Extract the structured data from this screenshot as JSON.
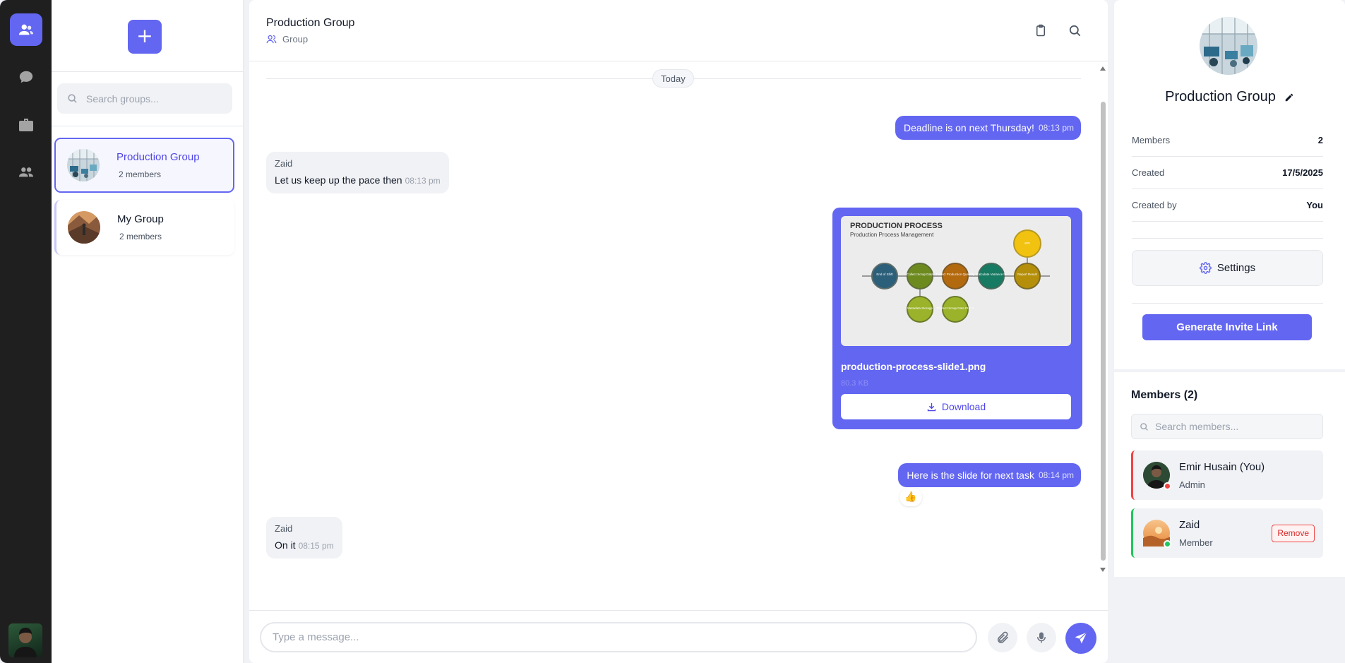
{
  "nav": {
    "items": [
      {
        "name": "groups",
        "icon": "users-icon",
        "active": true
      },
      {
        "name": "chats",
        "icon": "chat-bubble-icon",
        "active": false
      },
      {
        "name": "work",
        "icon": "briefcase-icon",
        "active": false
      },
      {
        "name": "contacts",
        "icon": "contacts-icon",
        "active": false
      }
    ]
  },
  "groups_panel": {
    "add_label": "+",
    "search_placeholder": "Search groups...",
    "groups": [
      {
        "name": "Production Group",
        "members": "2 members",
        "active": true
      },
      {
        "name": "My Group",
        "members": "2 members",
        "active": false
      }
    ]
  },
  "chat": {
    "title": "Production Group",
    "subtitle": "Group",
    "day_separator": "Today",
    "messages": [
      {
        "direction": "out",
        "text": "Deadline is on next Thursday!",
        "time": "08:13 pm"
      },
      {
        "direction": "in",
        "sender": "Zaid",
        "text": "Let us keep up the pace then",
        "time": "08:13 pm"
      },
      {
        "direction": "out",
        "type": "file",
        "file_name": "production-process-slide1.png",
        "file_size": "80.3 KB",
        "download_label": "Download",
        "preview": {
          "title": "PRODUCTION PROCESS",
          "subtitle": "Production Process Management",
          "nodes": [
            "End of Shift",
            "Collect Scrap Data",
            "Collect Production Quantity",
            "Calculate Variance %",
            "Report Result",
            "KPI",
            "Metadata Storage",
            "Product Scrap Data PLC 1"
          ]
        }
      },
      {
        "direction": "out",
        "text": "Here is the slide for next task",
        "time": "08:14 pm",
        "reaction": "👍"
      },
      {
        "direction": "in",
        "sender": "Zaid",
        "text": "On it",
        "time": "08:15 pm"
      }
    ],
    "composer_placeholder": "Type a message..."
  },
  "info": {
    "title": "Production Group",
    "details": [
      {
        "key": "Members",
        "value": "2"
      },
      {
        "key": "Created",
        "value": "17/5/2025"
      },
      {
        "key": "Created by",
        "value": "You"
      }
    ],
    "settings_label": "Settings",
    "invite_label": "Generate Invite Link",
    "members_title": "Members (2)",
    "members_search_placeholder": "Search members...",
    "members": [
      {
        "name": "Emir Husain (You)",
        "role": "Admin",
        "status_color": "#ef4444"
      },
      {
        "name": "Zaid",
        "role": "Member",
        "status_color": "#22c55e",
        "action": "Remove"
      }
    ]
  },
  "colors": {
    "accent": "#6366f1",
    "rail": "#1f1f1f",
    "danger": "#ef4444",
    "online": "#22c55e"
  }
}
